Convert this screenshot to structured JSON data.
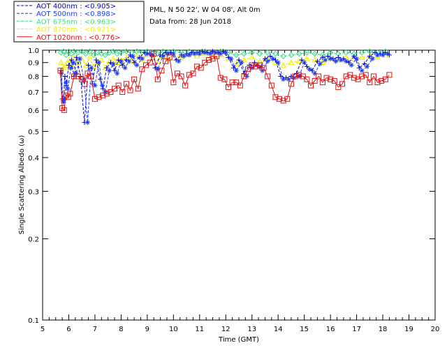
{
  "header": {
    "site_line": "PML, N 50 22', W 04 08', Alt 0m",
    "date_line": "Data from: 28 Jun 2018"
  },
  "chart_data": {
    "type": "scatter",
    "xlabel": "Time (GMT)",
    "ylabel": "Single Scattering Albedo (ω)",
    "xlim": [
      5,
      20
    ],
    "ylim": [
      0.1,
      1.0
    ],
    "yscale": "log",
    "x_ticks": [
      "5",
      "6",
      "7",
      "8",
      "9",
      "10",
      "11",
      "12",
      "13",
      "14",
      "15",
      "16",
      "17",
      "18",
      "19",
      "20"
    ],
    "y_ticks": [
      "0.1",
      "0.2",
      "0.3",
      "0.4",
      "0.5",
      "0.6",
      "0.7",
      "0.8",
      "0.9",
      "1.0"
    ],
    "grid": false,
    "legend_position": "top-left",
    "series": [
      {
        "name": "AOT 400nm : <0.905>",
        "color": "#0000cc",
        "marker": "plus",
        "line": "dash",
        "x": [
          5.7,
          5.75,
          5.8,
          5.85,
          5.9,
          6.0,
          6.1,
          6.2,
          6.3,
          6.45,
          6.6,
          6.75,
          6.9,
          7.05,
          7.2,
          7.3,
          7.45,
          7.6,
          7.75,
          7.9,
          8.05,
          8.2,
          8.35,
          8.5,
          8.7,
          8.9,
          9.1,
          9.3,
          9.5,
          9.7,
          9.9,
          10.1,
          10.3,
          10.5,
          10.7,
          10.9,
          11.1,
          11.3,
          11.5,
          11.7,
          11.9,
          12.1,
          12.3,
          12.5,
          12.7,
          12.9,
          13.1,
          13.3,
          13.5,
          13.7,
          13.9,
          14.1,
          14.3,
          14.5,
          14.7,
          14.9,
          15.1,
          15.3,
          15.5,
          15.7,
          15.9,
          16.1,
          16.3,
          16.5,
          16.7,
          16.9,
          17.1,
          17.3,
          17.5,
          17.7,
          17.9,
          18.1,
          18.25
        ],
        "y": [
          0.84,
          0.66,
          0.64,
          0.8,
          0.74,
          0.88,
          0.92,
          0.8,
          0.94,
          0.8,
          0.54,
          0.88,
          0.75,
          0.92,
          0.78,
          0.72,
          0.86,
          0.9,
          0.84,
          0.92,
          0.88,
          0.92,
          0.96,
          0.9,
          0.94,
          0.98,
          0.97,
          0.86,
          0.96,
          0.98,
          0.98,
          0.92,
          0.96,
          0.97,
          0.98,
          0.98,
          0.99,
          0.98,
          0.99,
          0.98,
          0.99,
          0.94,
          0.86,
          0.92,
          0.82,
          0.88,
          0.9,
          0.86,
          0.93,
          0.95,
          0.92,
          0.8,
          0.79,
          0.8,
          0.82,
          0.92,
          0.87,
          0.84,
          0.91,
          0.94,
          0.95,
          0.93,
          0.94,
          0.93,
          0.9,
          0.95,
          0.86,
          0.89,
          0.95,
          0.98,
          0.97,
          0.98,
          0.96
        ]
      },
      {
        "name": "AOT 500nm : <0.898>",
        "color": "#1a3cff",
        "marker": "star",
        "line": "dash",
        "x": [
          5.72,
          5.78,
          5.84,
          5.9,
          5.96,
          6.08,
          6.18,
          6.28,
          6.42,
          6.58,
          6.72,
          6.86,
          7.0,
          7.15,
          7.28,
          7.4,
          7.55,
          7.7,
          7.85,
          8.0,
          8.15,
          8.3,
          8.45,
          8.6,
          8.8,
          9.0,
          9.2,
          9.4,
          9.6,
          9.8,
          10.0,
          10.2,
          10.4,
          10.6,
          10.8,
          11.0,
          11.2,
          11.4,
          11.6,
          11.8,
          12.0,
          12.2,
          12.4,
          12.6,
          12.8,
          13.0,
          13.2,
          13.4,
          13.6,
          13.8,
          14.0,
          14.2,
          14.4,
          14.6,
          14.8,
          15.0,
          15.2,
          15.4,
          15.6,
          15.8,
          16.0,
          16.2,
          16.4,
          16.6,
          16.8,
          17.0,
          17.2,
          17.4,
          17.6,
          17.8,
          18.0,
          18.2
        ],
        "y": [
          0.82,
          0.65,
          0.66,
          0.76,
          0.72,
          0.86,
          0.9,
          0.82,
          0.93,
          0.78,
          0.54,
          0.86,
          0.74,
          0.9,
          0.74,
          0.7,
          0.84,
          0.89,
          0.82,
          0.91,
          0.86,
          0.91,
          0.95,
          0.88,
          0.93,
          0.97,
          0.96,
          0.85,
          0.95,
          0.97,
          0.97,
          0.91,
          0.95,
          0.96,
          0.97,
          0.97,
          0.98,
          0.97,
          0.98,
          0.97,
          0.98,
          0.93,
          0.84,
          0.9,
          0.8,
          0.86,
          0.88,
          0.84,
          0.91,
          0.93,
          0.9,
          0.78,
          0.78,
          0.79,
          0.8,
          0.9,
          0.85,
          0.82,
          0.89,
          0.92,
          0.93,
          0.91,
          0.92,
          0.91,
          0.88,
          0.93,
          0.84,
          0.87,
          0.93,
          0.96,
          0.96,
          0.97
        ]
      },
      {
        "name": "AOT 675nm : <0.963>",
        "color": "#33dd88",
        "marker": "diamond",
        "line": "dash",
        "x": [
          5.7,
          5.8,
          5.9,
          6.0,
          6.1,
          6.2,
          6.35,
          6.5,
          6.65,
          6.8,
          6.95,
          7.1,
          7.25,
          7.4,
          7.55,
          7.7,
          7.85,
          8.0,
          8.2,
          8.4,
          8.6,
          8.8,
          9.0,
          9.2,
          9.4,
          9.6,
          9.8,
          10.0,
          10.3,
          10.6,
          10.9,
          11.2,
          11.5,
          11.8,
          12.1,
          12.4,
          12.7,
          13.0,
          13.3,
          13.6,
          13.9,
          14.2,
          14.5,
          14.8,
          15.1,
          15.4,
          15.7,
          16.0,
          16.3,
          16.6,
          16.9,
          17.2,
          17.5,
          17.8,
          18.1
        ],
        "y": [
          0.98,
          0.99,
          0.96,
          0.99,
          0.97,
          0.99,
          0.98,
          0.99,
          0.97,
          0.99,
          0.96,
          0.98,
          0.97,
          0.96,
          0.98,
          0.99,
          0.97,
          0.98,
          0.99,
          0.98,
          0.99,
          0.98,
          0.99,
          0.98,
          0.97,
          0.99,
          0.98,
          0.99,
          0.98,
          0.99,
          0.98,
          0.99,
          0.98,
          0.99,
          0.98,
          0.96,
          0.97,
          0.98,
          0.97,
          0.98,
          0.97,
          0.95,
          0.96,
          0.97,
          0.98,
          0.97,
          0.96,
          0.98,
          0.97,
          0.98,
          0.97,
          0.98,
          0.99,
          0.98,
          0.99
        ]
      },
      {
        "name": "AOT 870nm : <0.921>",
        "color": "#eeee00",
        "marker": "triangle",
        "line": "dash",
        "x": [
          5.7,
          5.8,
          5.9,
          6.0,
          6.1,
          6.2,
          6.35,
          6.5,
          6.65,
          6.8,
          6.95,
          7.1,
          7.25,
          7.4,
          7.55,
          7.7,
          7.85,
          8.0,
          8.2,
          8.4,
          8.6,
          8.8,
          9.0,
          9.2,
          9.4,
          9.6,
          9.8,
          10.0,
          10.3,
          10.6,
          10.9,
          11.2,
          11.5,
          11.8,
          12.1,
          12.4,
          12.7,
          13.0,
          13.3,
          13.6,
          13.9,
          14.2,
          14.5,
          14.8,
          15.1,
          15.4,
          15.7,
          16.0,
          16.3,
          16.6,
          16.9,
          17.2,
          17.5,
          17.8,
          18.1
        ],
        "y": [
          0.9,
          0.86,
          0.88,
          0.92,
          0.89,
          0.94,
          0.9,
          0.93,
          0.88,
          0.94,
          0.87,
          0.9,
          0.92,
          0.86,
          0.91,
          0.93,
          0.9,
          0.92,
          0.94,
          0.91,
          0.95,
          0.92,
          0.96,
          0.94,
          0.91,
          0.95,
          0.93,
          0.96,
          0.94,
          0.96,
          0.95,
          0.97,
          0.94,
          0.96,
          0.93,
          0.89,
          0.92,
          0.94,
          0.91,
          0.93,
          0.9,
          0.88,
          0.9,
          0.91,
          0.93,
          0.92,
          0.9,
          0.93,
          0.92,
          0.94,
          0.93,
          0.94,
          0.95,
          0.94,
          0.96
        ]
      },
      {
        "name": "AOT 1020nm : <0.776>",
        "color": "#dd1111",
        "marker": "square",
        "line": "solid",
        "x": [
          5.68,
          5.75,
          5.82,
          5.9,
          5.98,
          6.05,
          6.2,
          6.35,
          6.5,
          6.6,
          6.72,
          6.85,
          7.0,
          7.15,
          7.3,
          7.45,
          7.6,
          7.75,
          7.9,
          8.05,
          8.2,
          8.35,
          8.5,
          8.65,
          8.8,
          8.95,
          9.1,
          9.25,
          9.4,
          9.55,
          9.7,
          9.85,
          10.0,
          10.15,
          10.3,
          10.45,
          10.6,
          10.75,
          10.9,
          11.05,
          11.2,
          11.35,
          11.5,
          11.65,
          11.8,
          11.95,
          12.1,
          12.25,
          12.4,
          12.55,
          12.7,
          12.85,
          13.0,
          13.15,
          13.3,
          13.45,
          13.6,
          13.75,
          13.9,
          14.05,
          14.2,
          14.35,
          14.5,
          14.65,
          14.8,
          14.95,
          15.1,
          15.25,
          15.4,
          15.55,
          15.7,
          15.85,
          16.0,
          16.15,
          16.3,
          16.45,
          16.6,
          16.75,
          16.9,
          17.05,
          17.2,
          17.35,
          17.5,
          17.65,
          17.8,
          17.95,
          18.1,
          18.25
        ],
        "y": [
          0.84,
          0.61,
          0.6,
          0.68,
          0.67,
          0.69,
          0.8,
          0.8,
          0.78,
          0.75,
          0.82,
          0.8,
          0.66,
          0.67,
          0.68,
          0.69,
          0.7,
          0.72,
          0.74,
          0.7,
          0.75,
          0.71,
          0.78,
          0.72,
          0.85,
          0.88,
          0.9,
          0.97,
          0.78,
          0.84,
          0.91,
          0.94,
          0.76,
          0.82,
          0.8,
          0.74,
          0.81,
          0.82,
          0.87,
          0.86,
          0.9,
          0.92,
          0.93,
          0.95,
          0.79,
          0.78,
          0.73,
          0.76,
          0.76,
          0.74,
          0.8,
          0.85,
          0.88,
          0.87,
          0.88,
          0.86,
          0.8,
          0.74,
          0.67,
          0.66,
          0.65,
          0.66,
          0.75,
          0.8,
          0.81,
          0.8,
          0.78,
          0.74,
          0.77,
          0.8,
          0.76,
          0.79,
          0.78,
          0.77,
          0.73,
          0.75,
          0.8,
          0.81,
          0.79,
          0.78,
          0.8,
          0.81,
          0.76,
          0.8,
          0.76,
          0.77,
          0.78,
          0.81
        ]
      }
    ]
  }
}
